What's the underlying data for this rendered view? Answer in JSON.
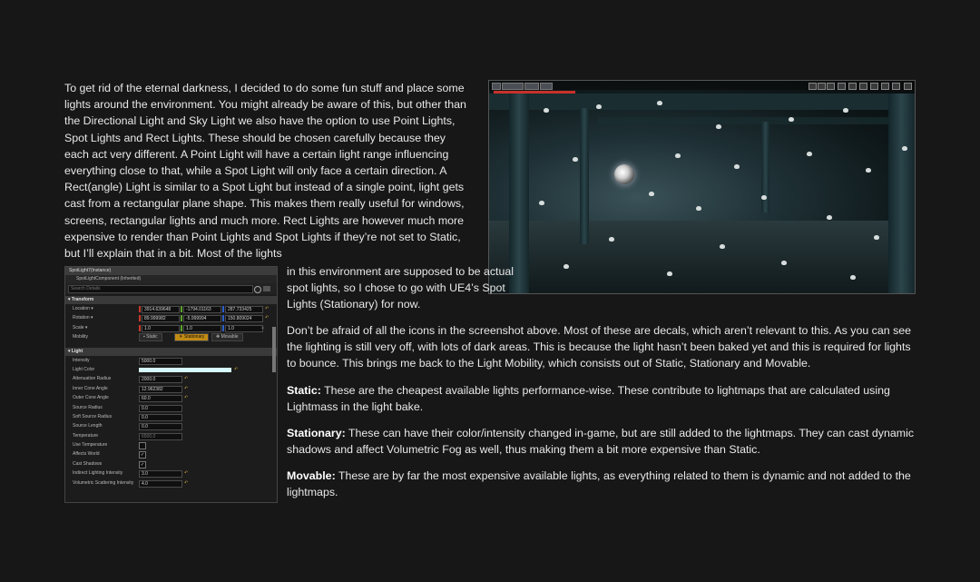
{
  "paragraphs": {
    "intro": "To get rid of the eternal darkness, I decided to do some fun stuff and place some lights around the environment. You might already be aware of this, but other than the Directional Light and Sky Light we also have the option to use Point Lights, Spot Lights and Rect Lights. These should be chosen carefully because they each act very different. A Point Light will have a certain light range influencing everything close to that, while a Spot Light will only face a certain direction. A Rect(angle) Light is similar to a Spot Light but instead of a single point, light gets cast from a rectangular plane shape. This makes them really useful for windows, screens, rectangular lights and much more. Rect Lights are however much more expensive to render than Point Lights and Spot Lights if they’re not set to Static, but I’ll explain that in a bit. Most of the lights",
    "intro_cont": "in this environment are supposed to be actual spot lights, so I chose to go with UE4’s Spot Lights (Stationary) for now.",
    "icons": "Don’t be afraid of all the icons in the screenshot above. Most of these are decals, which aren’t relevant to this. As you can see the lighting is still very off, with lots of dark areas. This is because the light hasn’t been baked yet and this is required for lights to bounce. This brings me back to the Light Mobility, which consists out of Static, Stationary and Movable.",
    "static_label": "Static:",
    "static_text": " These are the cheapest available lights performance-wise. These contribute to lightmaps that are calculated using Lightmass in the light bake.",
    "stationary_label": "Stationary:",
    "stationary_text": " These can have their color/intensity changed in-game, but are still added to the lightmaps. They can cast dynamic shadows and affect Volumetric Fog as well, thus making them a bit more expensive than Static.",
    "movable_label": "Movable:",
    "movable_text": " These are by far the most expensive available lights, as everything related to them is dynamic and not added to the lightmaps."
  },
  "details_panel": {
    "title": "SpotLight7(Instance)",
    "component": "SpotLightComponent (Inherited)",
    "search_placeholder": "Search Details",
    "transform_header": "Transform",
    "location_label": "Location ▾",
    "location": [
      "3914.639648",
      "-1794.01163",
      "287.733425"
    ],
    "rotation_label": "Rotation ▾",
    "rotation": [
      "89.999982",
      "-5.999994",
      "150.809024"
    ],
    "scale_label": "Scale ▾",
    "scale": [
      "1.0",
      "1.0",
      "1.0"
    ],
    "mobility_label": "Mobility",
    "mobility_options": [
      "Static",
      "Stationary",
      "Movable"
    ],
    "mobility_selected": "Stationary",
    "light_header": "Light",
    "props": [
      {
        "label": "Intensity",
        "value": "5000.0"
      },
      {
        "label": "Light Color",
        "value": ""
      },
      {
        "label": "Attenuation Radius",
        "value": "2000.0"
      },
      {
        "label": "Inner Cone Angle",
        "value": "12.962382"
      },
      {
        "label": "Outer Cone Angle",
        "value": "60.0"
      },
      {
        "label": "Source Radius",
        "value": "0.0"
      },
      {
        "label": "Soft Source Radius",
        "value": "0.0"
      },
      {
        "label": "Source Length",
        "value": "0.0"
      },
      {
        "label": "Temperature",
        "value": "6500.0"
      },
      {
        "label": "Use Temperature",
        "value": ""
      },
      {
        "label": "Affects World",
        "value": "✓"
      },
      {
        "label": "Cast Shadows",
        "value": "✓"
      },
      {
        "label": "Indirect Lighting Intensity",
        "value": "3.0"
      },
      {
        "label": "Volumetric Scattering Intensity",
        "value": "4.0"
      }
    ]
  },
  "viewport": {
    "toolbar_buttons": [
      "Perspective",
      "Lit",
      "Show"
    ],
    "warning_color": "#c8322a"
  },
  "colors": {
    "background": "#171717",
    "text": "#e8e8e8",
    "accent_mobility": "#c28a14",
    "light_color_swatch": "#d6fbff"
  }
}
